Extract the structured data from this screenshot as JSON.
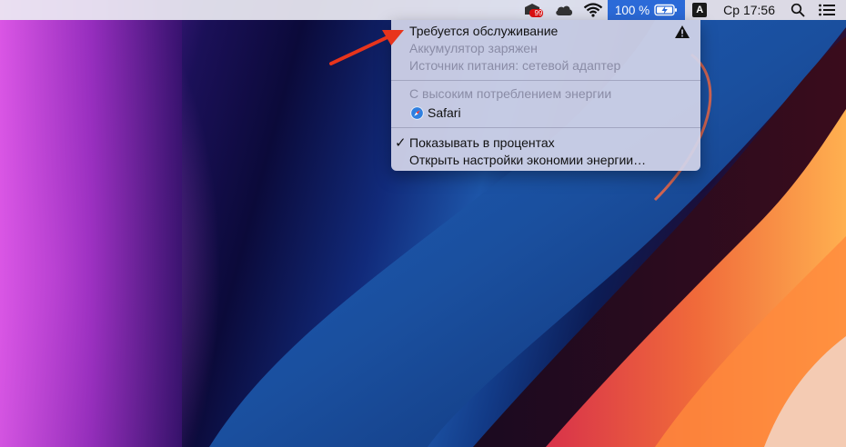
{
  "menubar": {
    "notification_badge": "99",
    "battery_percent": "100 %",
    "input_source": "A",
    "clock": "Ср 17:56"
  },
  "battery_menu": {
    "header": "Требуется обслуживание",
    "status_charged": "Аккумулятор заряжен",
    "power_source": "Источник питания: сетевой адаптер",
    "high_energy_header": "С высоким потреблением энергии",
    "high_energy_apps": [
      {
        "label": "Safari",
        "icon": "safari-icon"
      }
    ],
    "show_percent": "Показывать в процентах",
    "show_percent_checked": true,
    "open_settings": "Открыть настройки экономии энергии…"
  },
  "colors": {
    "accent": "#2b6ad8",
    "arrow": "#e8341c",
    "disabled_text": "#8a8ca6"
  }
}
